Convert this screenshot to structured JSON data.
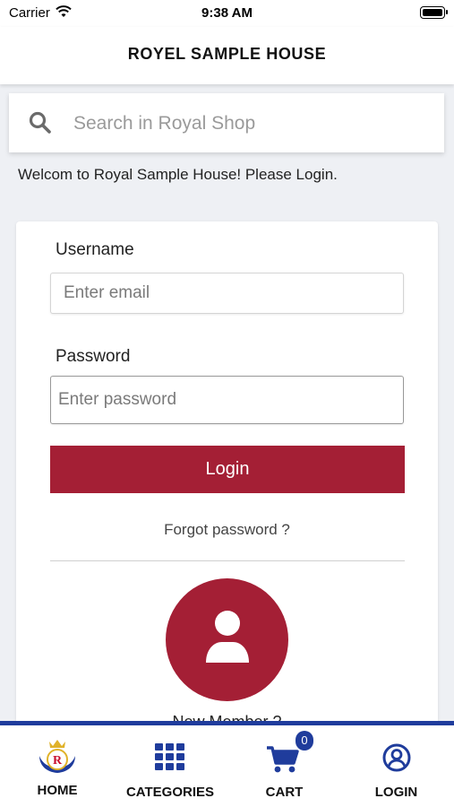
{
  "status_bar": {
    "carrier": "Carrier",
    "time": "9:38 AM"
  },
  "header": {
    "title": "ROYEL SAMPLE HOUSE"
  },
  "search": {
    "placeholder": "Search in Royal Shop"
  },
  "welcome_text": "Welcom to Royal Sample House! Please Login.",
  "login_form": {
    "username_label": "Username",
    "username_placeholder": "Enter email",
    "password_label": "Password",
    "password_placeholder": "Enter password",
    "login_button": "Login",
    "forgot_link": "Forgot password ?",
    "new_member_text": "New Member ?"
  },
  "tab_bar": {
    "items": [
      {
        "label": "HOME",
        "icon": "royal-logo-icon"
      },
      {
        "label": "CATEGORIES",
        "icon": "grid-icon"
      },
      {
        "label": "CART",
        "icon": "cart-icon"
      },
      {
        "label": "LOGIN",
        "icon": "user-circle-icon"
      }
    ],
    "cart_count": "0",
    "logo_letter": "R"
  },
  "colors": {
    "primary": "#a41f35",
    "nav_blue": "#1f3c9c",
    "background": "#eef0f4"
  }
}
